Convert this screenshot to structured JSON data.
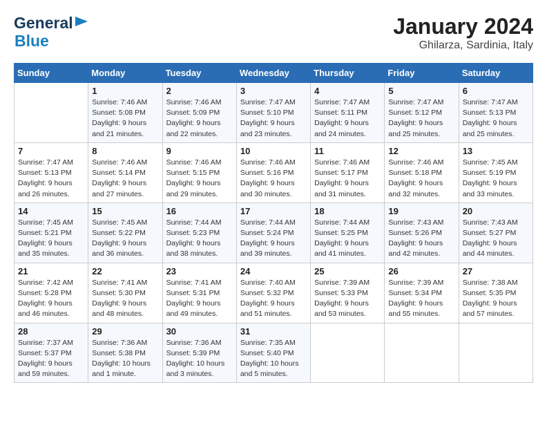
{
  "header": {
    "logo_general": "General",
    "logo_blue": "Blue",
    "title": "January 2024",
    "subtitle": "Ghilarza, Sardinia, Italy"
  },
  "calendar": {
    "days_of_week": [
      "Sunday",
      "Monday",
      "Tuesday",
      "Wednesday",
      "Thursday",
      "Friday",
      "Saturday"
    ],
    "weeks": [
      [
        {
          "day": "",
          "info": ""
        },
        {
          "day": "1",
          "info": "Sunrise: 7:46 AM\nSunset: 5:08 PM\nDaylight: 9 hours\nand 21 minutes."
        },
        {
          "day": "2",
          "info": "Sunrise: 7:46 AM\nSunset: 5:09 PM\nDaylight: 9 hours\nand 22 minutes."
        },
        {
          "day": "3",
          "info": "Sunrise: 7:47 AM\nSunset: 5:10 PM\nDaylight: 9 hours\nand 23 minutes."
        },
        {
          "day": "4",
          "info": "Sunrise: 7:47 AM\nSunset: 5:11 PM\nDaylight: 9 hours\nand 24 minutes."
        },
        {
          "day": "5",
          "info": "Sunrise: 7:47 AM\nSunset: 5:12 PM\nDaylight: 9 hours\nand 25 minutes."
        },
        {
          "day": "6",
          "info": "Sunrise: 7:47 AM\nSunset: 5:13 PM\nDaylight: 9 hours\nand 25 minutes."
        }
      ],
      [
        {
          "day": "7",
          "info": "Sunrise: 7:47 AM\nSunset: 5:13 PM\nDaylight: 9 hours\nand 26 minutes."
        },
        {
          "day": "8",
          "info": "Sunrise: 7:46 AM\nSunset: 5:14 PM\nDaylight: 9 hours\nand 27 minutes."
        },
        {
          "day": "9",
          "info": "Sunrise: 7:46 AM\nSunset: 5:15 PM\nDaylight: 9 hours\nand 29 minutes."
        },
        {
          "day": "10",
          "info": "Sunrise: 7:46 AM\nSunset: 5:16 PM\nDaylight: 9 hours\nand 30 minutes."
        },
        {
          "day": "11",
          "info": "Sunrise: 7:46 AM\nSunset: 5:17 PM\nDaylight: 9 hours\nand 31 minutes."
        },
        {
          "day": "12",
          "info": "Sunrise: 7:46 AM\nSunset: 5:18 PM\nDaylight: 9 hours\nand 32 minutes."
        },
        {
          "day": "13",
          "info": "Sunrise: 7:45 AM\nSunset: 5:19 PM\nDaylight: 9 hours\nand 33 minutes."
        }
      ],
      [
        {
          "day": "14",
          "info": "Sunrise: 7:45 AM\nSunset: 5:21 PM\nDaylight: 9 hours\nand 35 minutes."
        },
        {
          "day": "15",
          "info": "Sunrise: 7:45 AM\nSunset: 5:22 PM\nDaylight: 9 hours\nand 36 minutes."
        },
        {
          "day": "16",
          "info": "Sunrise: 7:44 AM\nSunset: 5:23 PM\nDaylight: 9 hours\nand 38 minutes."
        },
        {
          "day": "17",
          "info": "Sunrise: 7:44 AM\nSunset: 5:24 PM\nDaylight: 9 hours\nand 39 minutes."
        },
        {
          "day": "18",
          "info": "Sunrise: 7:44 AM\nSunset: 5:25 PM\nDaylight: 9 hours\nand 41 minutes."
        },
        {
          "day": "19",
          "info": "Sunrise: 7:43 AM\nSunset: 5:26 PM\nDaylight: 9 hours\nand 42 minutes."
        },
        {
          "day": "20",
          "info": "Sunrise: 7:43 AM\nSunset: 5:27 PM\nDaylight: 9 hours\nand 44 minutes."
        }
      ],
      [
        {
          "day": "21",
          "info": "Sunrise: 7:42 AM\nSunset: 5:28 PM\nDaylight: 9 hours\nand 46 minutes."
        },
        {
          "day": "22",
          "info": "Sunrise: 7:41 AM\nSunset: 5:30 PM\nDaylight: 9 hours\nand 48 minutes."
        },
        {
          "day": "23",
          "info": "Sunrise: 7:41 AM\nSunset: 5:31 PM\nDaylight: 9 hours\nand 49 minutes."
        },
        {
          "day": "24",
          "info": "Sunrise: 7:40 AM\nSunset: 5:32 PM\nDaylight: 9 hours\nand 51 minutes."
        },
        {
          "day": "25",
          "info": "Sunrise: 7:39 AM\nSunset: 5:33 PM\nDaylight: 9 hours\nand 53 minutes."
        },
        {
          "day": "26",
          "info": "Sunrise: 7:39 AM\nSunset: 5:34 PM\nDaylight: 9 hours\nand 55 minutes."
        },
        {
          "day": "27",
          "info": "Sunrise: 7:38 AM\nSunset: 5:35 PM\nDaylight: 9 hours\nand 57 minutes."
        }
      ],
      [
        {
          "day": "28",
          "info": "Sunrise: 7:37 AM\nSunset: 5:37 PM\nDaylight: 9 hours\nand 59 minutes."
        },
        {
          "day": "29",
          "info": "Sunrise: 7:36 AM\nSunset: 5:38 PM\nDaylight: 10 hours\nand 1 minute."
        },
        {
          "day": "30",
          "info": "Sunrise: 7:36 AM\nSunset: 5:39 PM\nDaylight: 10 hours\nand 3 minutes."
        },
        {
          "day": "31",
          "info": "Sunrise: 7:35 AM\nSunset: 5:40 PM\nDaylight: 10 hours\nand 5 minutes."
        },
        {
          "day": "",
          "info": ""
        },
        {
          "day": "",
          "info": ""
        },
        {
          "day": "",
          "info": ""
        }
      ]
    ]
  }
}
